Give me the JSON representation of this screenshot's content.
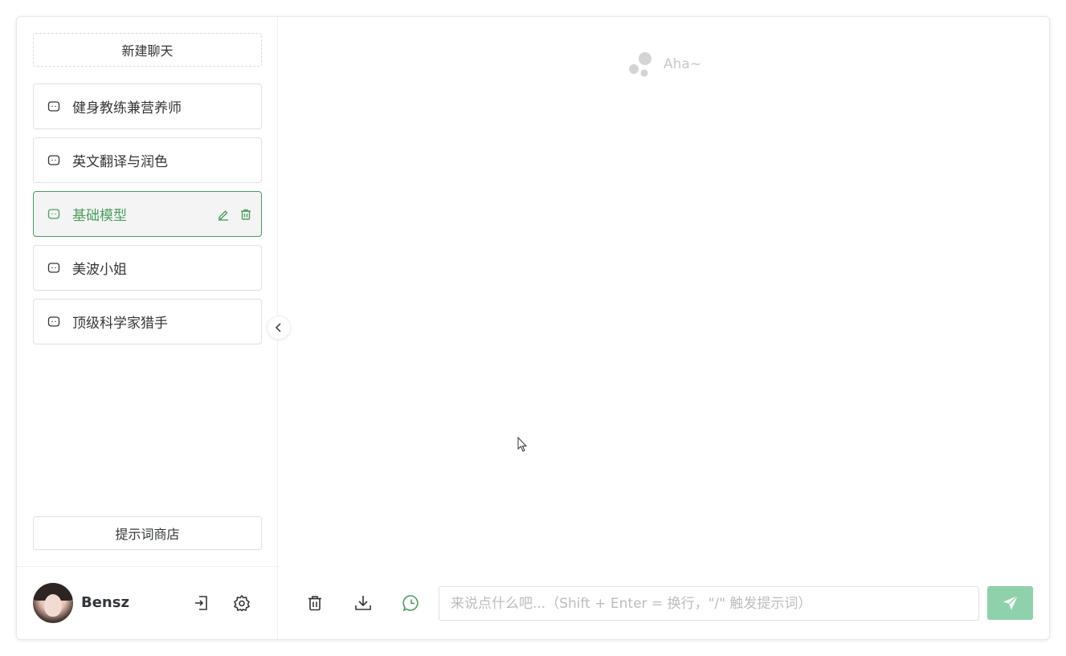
{
  "sidebar": {
    "new_chat_label": "新建聊天",
    "items": [
      {
        "label": "健身教练兼营养师",
        "icon": "chat-bubble-icon",
        "active": false
      },
      {
        "label": "英文翻译与润色",
        "icon": "chat-bubble-icon",
        "active": false
      },
      {
        "label": "基础模型",
        "icon": "chat-bubble-icon",
        "active": true,
        "actions": [
          "edit-icon",
          "trash-icon"
        ]
      },
      {
        "label": "美波小姐",
        "icon": "chat-bubble-icon",
        "active": false
      },
      {
        "label": "顶级科学家猎手",
        "icon": "chat-bubble-icon",
        "active": false
      }
    ],
    "collapse_icon": "chevron-left-icon",
    "prompt_store_label": "提示词商店",
    "user": {
      "name": "Bensz",
      "actions": [
        "logout-icon",
        "gear-icon"
      ]
    }
  },
  "main": {
    "empty_state": {
      "text": "Aha~",
      "icon": "bubbles-icon"
    },
    "footer": {
      "buttons": [
        "trash-icon",
        "download-icon",
        "whatsapp-icon"
      ],
      "input_placeholder": "来说点什么吧...（Shift + Enter = 换行，\"/\" 触发提示词）",
      "input_value": "",
      "send_icon": "send-icon"
    }
  },
  "colors": {
    "accent": "#4b9e5f",
    "send_button": "#8fd1aa",
    "border": "#e0e0e6",
    "placeholder": "#bcbcbc"
  }
}
